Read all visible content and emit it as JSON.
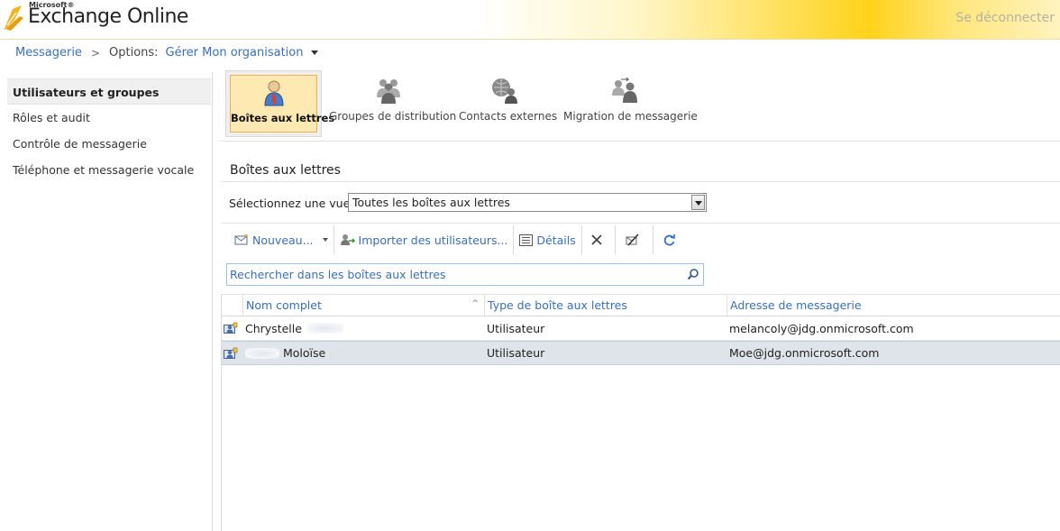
{
  "header": {
    "brand_small": "Microsoft®",
    "brand": "Exchange Online",
    "signout": "Se déconnecter"
  },
  "breadcrumb": {
    "item1": "Messagerie",
    "label": "Options:",
    "item2": "Gérer Mon organisation"
  },
  "sidebar": {
    "items": [
      {
        "label": "Utilisateurs et groupes"
      },
      {
        "label": "Rôles et audit"
      },
      {
        "label": "Contrôle de messagerie"
      },
      {
        "label": "Téléphone et messagerie vocale"
      }
    ]
  },
  "icon_tabs": [
    {
      "label": "Boîtes aux lettres",
      "icon": "mailbox-user-icon"
    },
    {
      "label": "Groupes de distribution",
      "icon": "distribution-group-icon"
    },
    {
      "label": "Contacts externes",
      "icon": "external-contact-icon"
    },
    {
      "label": "Migration de messagerie",
      "icon": "migration-icon"
    }
  ],
  "main": {
    "title": "Boîtes aux lettres",
    "view_label": "Sélectionnez une vue :",
    "view_value": "Toutes les boîtes aux lettres",
    "toolbar": {
      "new": "Nouveau...",
      "import": "Importer des utilisateurs...",
      "details": "Détails"
    },
    "search_placeholder": "Rechercher dans les boîtes aux lettres",
    "columns": [
      "Nom complet",
      "Type de boîte aux lettres",
      "Adresse de messagerie"
    ],
    "rows": [
      {
        "name": "Chrystelle",
        "type": "Utilisateur",
        "email": "melancoly@jdg.onmicrosoft.com"
      },
      {
        "name": "Moloïse",
        "type": "Utilisateur",
        "email": "Moe@jdg.onmicrosoft.com"
      }
    ]
  },
  "colors": {
    "link": "#3b6fb5",
    "selected_tab_bg": "#ffe9b3",
    "selected_row_bg": "#dfe3ea"
  }
}
